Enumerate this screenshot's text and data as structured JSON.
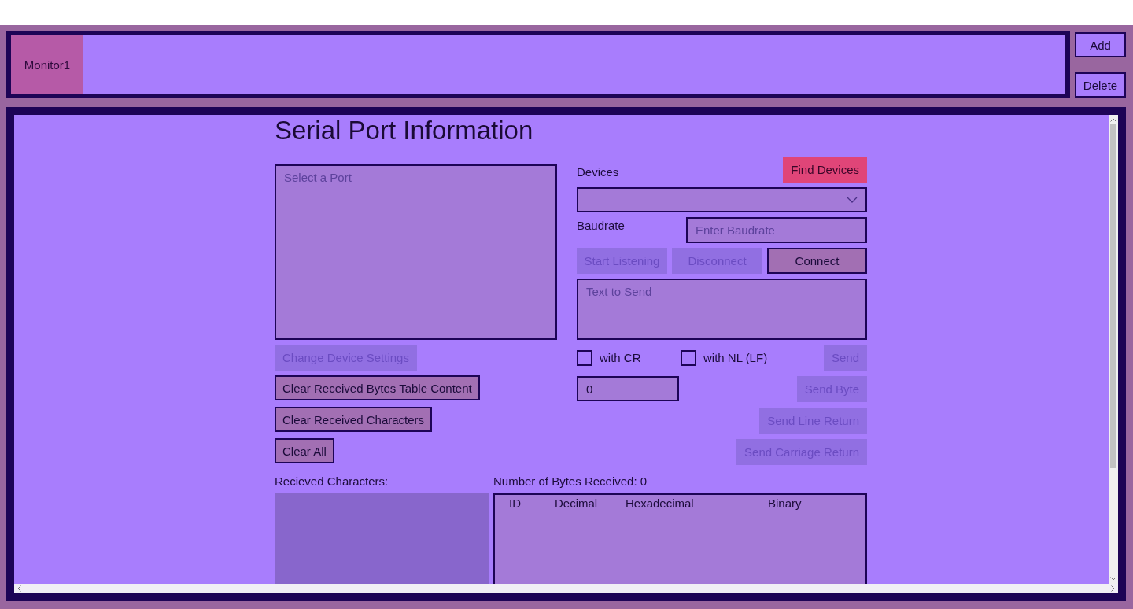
{
  "tabs": [
    {
      "label": "Monitor1",
      "selected": true
    }
  ],
  "tab_actions": [
    "Add",
    "Delete"
  ],
  "panel": {
    "title": "Serial Port Information",
    "port_list": {
      "placeholder": "Select a Port"
    },
    "port_buttons": [
      {
        "label": "Change Device Settings",
        "disabled": true
      },
      {
        "label": "Clear Received Bytes Table Content",
        "disabled": false
      },
      {
        "label": "Clear Received Characters",
        "disabled": false
      },
      {
        "label": "Clear All",
        "disabled": false
      }
    ],
    "devices": {
      "label": "Devices",
      "find_button": {
        "label": "Find Devices",
        "disabled": false
      }
    },
    "baudrate": {
      "label": "Baudrate",
      "placeholder": "Enter Baudrate"
    },
    "connection_buttons": [
      {
        "label": "Start Listening",
        "disabled": true
      },
      {
        "label": "Disconnect",
        "disabled": true
      },
      {
        "label": "Connect",
        "disabled": false
      }
    ],
    "text_to_send": {
      "placeholder": "Text to Send"
    },
    "line_endings": [
      {
        "label": "with CR",
        "checked": false
      },
      {
        "label": "with NL (LF)",
        "checked": false
      }
    ],
    "send_button": {
      "label": "Send",
      "disabled": true
    },
    "byte_input": {
      "value": "0"
    },
    "byte_buttons": [
      {
        "label": "Send Byte",
        "disabled": true
      },
      {
        "label": "Send Line Return",
        "disabled": true
      },
      {
        "label": "Send Carriage Return",
        "disabled": true
      }
    ],
    "received_characters": {
      "label": "Recieved Characters:"
    },
    "bytes_table": {
      "label": "Number of Bytes Received: 0",
      "columns": [
        "ID",
        "Decimal",
        "Hexadecimal",
        "Binary"
      ]
    }
  }
}
